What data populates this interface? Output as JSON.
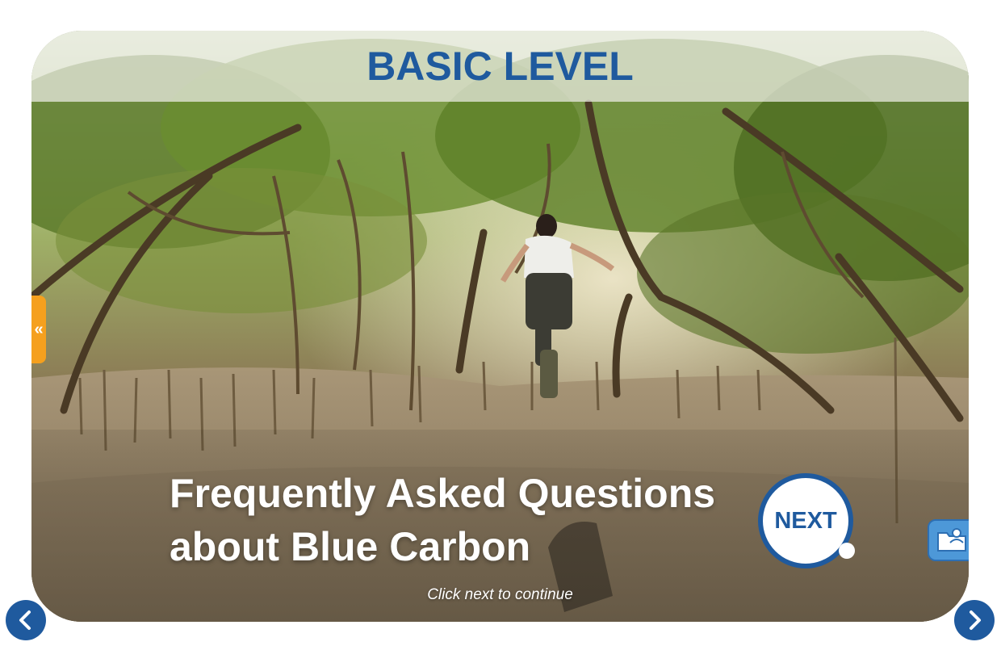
{
  "header": {
    "level_title": "BASIC LEVEL"
  },
  "hero": {
    "title_line1": "Frequently Asked Questions",
    "title_line2": "about Blue Carbon",
    "hint": "Click next to continue"
  },
  "buttons": {
    "next_label": "NEXT",
    "side_tab_label": "«"
  },
  "icons": {
    "prev": "chevron-left-icon",
    "next": "chevron-right-icon",
    "folder": "folder-profile-icon"
  },
  "colors": {
    "brand_blue": "#1f5a9e",
    "accent_orange": "#f5a01e",
    "folder_blue": "#4d98d8"
  }
}
